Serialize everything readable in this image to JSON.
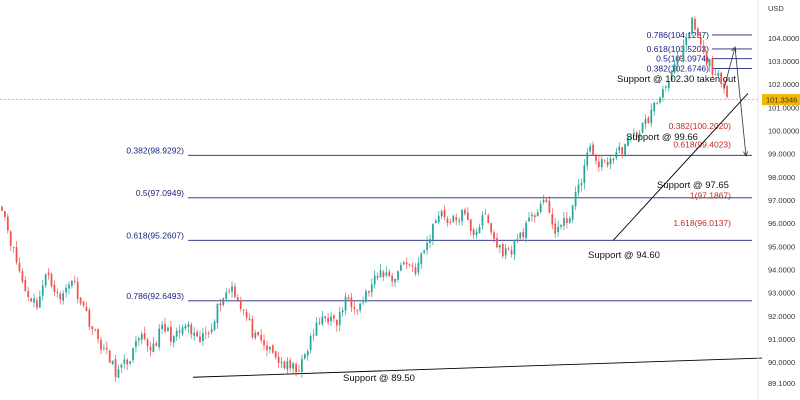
{
  "chart_data": {
    "type": "candlestick",
    "instrument_unit": "USD",
    "ylim": [
      88.8,
      105.2
    ],
    "y_ticks": [
      "89.1000",
      "90.0000",
      "91.0000",
      "92.0000",
      "93.0000",
      "94.0000",
      "95.0000",
      "96.0000",
      "97.0000",
      "98.0000",
      "99.0000",
      "100.0000",
      "101.0000",
      "102.0000",
      "103.0000",
      "104.0000"
    ],
    "last_price": "101.3346",
    "grid": false,
    "colors": {
      "up": "#26a69a",
      "down": "#ef5350",
      "fib_line": "#1a237e",
      "fib_text_blue": "#1a237e",
      "fib_text_red": "#c62828",
      "trendline": "#000000",
      "price_tag": "#f2b705",
      "price_line": "#f2b705"
    },
    "fib_levels_long": [
      {
        "label": "0.382(98.9292)",
        "value": 98.9292
      },
      {
        "label": "0.5(97.0949)",
        "value": 97.0949
      },
      {
        "label": "0.618(95.2607)",
        "value": 95.2607
      },
      {
        "label": "0.786(92.6493)",
        "value": 92.6493
      }
    ],
    "fib_levels_short": [
      {
        "label": "0.786(104.1237)",
        "value": 104.1237
      },
      {
        "label": "0.618(103.5203)",
        "value": 103.5203
      },
      {
        "label": "0.5(103.0974)",
        "value": 103.0974
      },
      {
        "label": "0.382(102.6746)",
        "value": 102.6746
      }
    ],
    "fib_extension": [
      {
        "label": "0.382(100.2020)",
        "value": 100.202
      },
      {
        "label": "0.618(99.4023)",
        "value": 99.4023
      },
      {
        "label": "1(97.1867)",
        "value": 97.1867
      },
      {
        "label": "1.618(96.0137)",
        "value": 96.0137
      }
    ],
    "annotations": [
      {
        "text": "Support @ 102.30 taken out",
        "value": 102.3
      },
      {
        "text": "Support @ 99.66",
        "value": 99.66
      },
      {
        "text": "Support @ 97.65",
        "value": 97.65
      },
      {
        "text": "Support @ 94.60",
        "value": 94.6
      },
      {
        "text": "Support @ 89.50",
        "value": 89.5
      }
    ],
    "anchors": [
      96.8,
      94.8,
      93.1,
      92.5,
      93.9,
      92.6,
      93.7,
      92.5,
      91.3,
      90.4,
      89.5,
      90.1,
      91.0,
      90.6,
      91.5,
      91.0,
      91.6,
      90.8,
      91.4,
      92.7,
      93.3,
      92.2,
      91.0,
      90.6,
      90.1,
      89.7,
      89.8,
      91.2,
      92.1,
      91.6,
      92.8,
      92.4,
      93.2,
      93.9,
      93.6,
      94.4,
      94.0,
      95.2,
      96.6,
      96.0,
      96.4,
      95.6,
      96.3,
      95.0,
      94.7,
      95.5,
      96.1,
      97.1,
      95.7,
      96.0,
      97.3,
      99.2,
      98.5,
      98.8,
      99.3,
      99.8,
      100.4,
      101.3,
      102.4,
      103.1,
      104.7,
      103.2,
      102.5,
      101.3
    ]
  }
}
